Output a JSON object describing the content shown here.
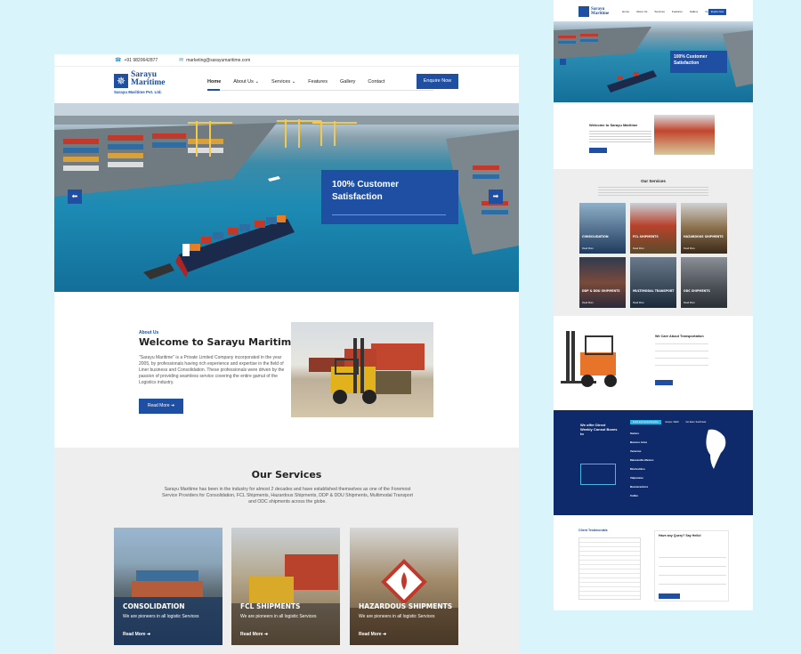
{
  "topbar": {
    "phone": "+91 9820642877",
    "email": "marketing@sarayumaritime.com"
  },
  "logo": {
    "line1": "Sarayu",
    "line2": "Maritime",
    "tagline": "Sarayu Maritime Pvt. Ltd."
  },
  "nav": {
    "items": [
      "Home",
      "About Us",
      "Services",
      "Features",
      "Gallery",
      "Contact"
    ],
    "active": "Home"
  },
  "enquire_label": "Enquire Now",
  "hero": {
    "caption_line1": "100% Customer",
    "caption_line2": "Satisfaction"
  },
  "about": {
    "kicker": "About Us",
    "title": "Welcome to Sarayu Maritime",
    "body": "\"Sarayu Maritime\" is a Private Limited Company incorporated in the year 2005, by professionals having rich experience and expertise in the field of Liner business and Consolidation. These professionals were driven by the passion of providing seamless service covering the entire gamut of the Logistics industry.",
    "read_more": "Read More"
  },
  "services": {
    "title": "Our Services",
    "body": "Sarayu Maritime has been in the industry for almost 2 decades and have established themselves as one of the Foremost Service Providers for Consolidation, FCL Shipments, Hazardous Shipments, DDP & DDU Shipments, Multimodal Transport and ODC shipments across the globe.",
    "cards": [
      {
        "title": "CONSOLIDATION",
        "sub": "We are pioneers in all logistic Services",
        "link": "Read More"
      },
      {
        "title": "FCL SHIPMENTS",
        "sub": "We are pioneers in all logistic Services",
        "link": "Read More"
      },
      {
        "title": "HAZARDOUS SHIPMENTS",
        "sub": "We are pioneers in all logistic Services",
        "link": "Read More"
      }
    ]
  },
  "preview": {
    "hero_caption": "100% Customer Satisfaction",
    "about_title": "Welcome to Sarayu Maritime",
    "services_title": "Our Services",
    "service_tiles": [
      "CONSOLIDATION",
      "FCL SHIPMENTS",
      "HAZARDOUS SHIPMENTS",
      "DDP & DDU SHIPMENTS",
      "MULTIMODAL TRANSPORT",
      "ODC SHIPMENTS"
    ],
    "transport_title": "We Care About Transportation",
    "direct_title": "We offer Direct Weekly Consol Boxes to",
    "tabs": [
      "South and Central America",
      "Europe / MED",
      "Far East / South East"
    ],
    "ports": [
      "Santos",
      "Buenos Aires",
      "Veracruz",
      "Manzanillo-Mexico",
      "Montevideo",
      "Valparaiso",
      "Buenaventura",
      "Callao"
    ],
    "testimonials_title": "Client Testimonials",
    "query_title": "Have any Query? Say Hello!"
  }
}
